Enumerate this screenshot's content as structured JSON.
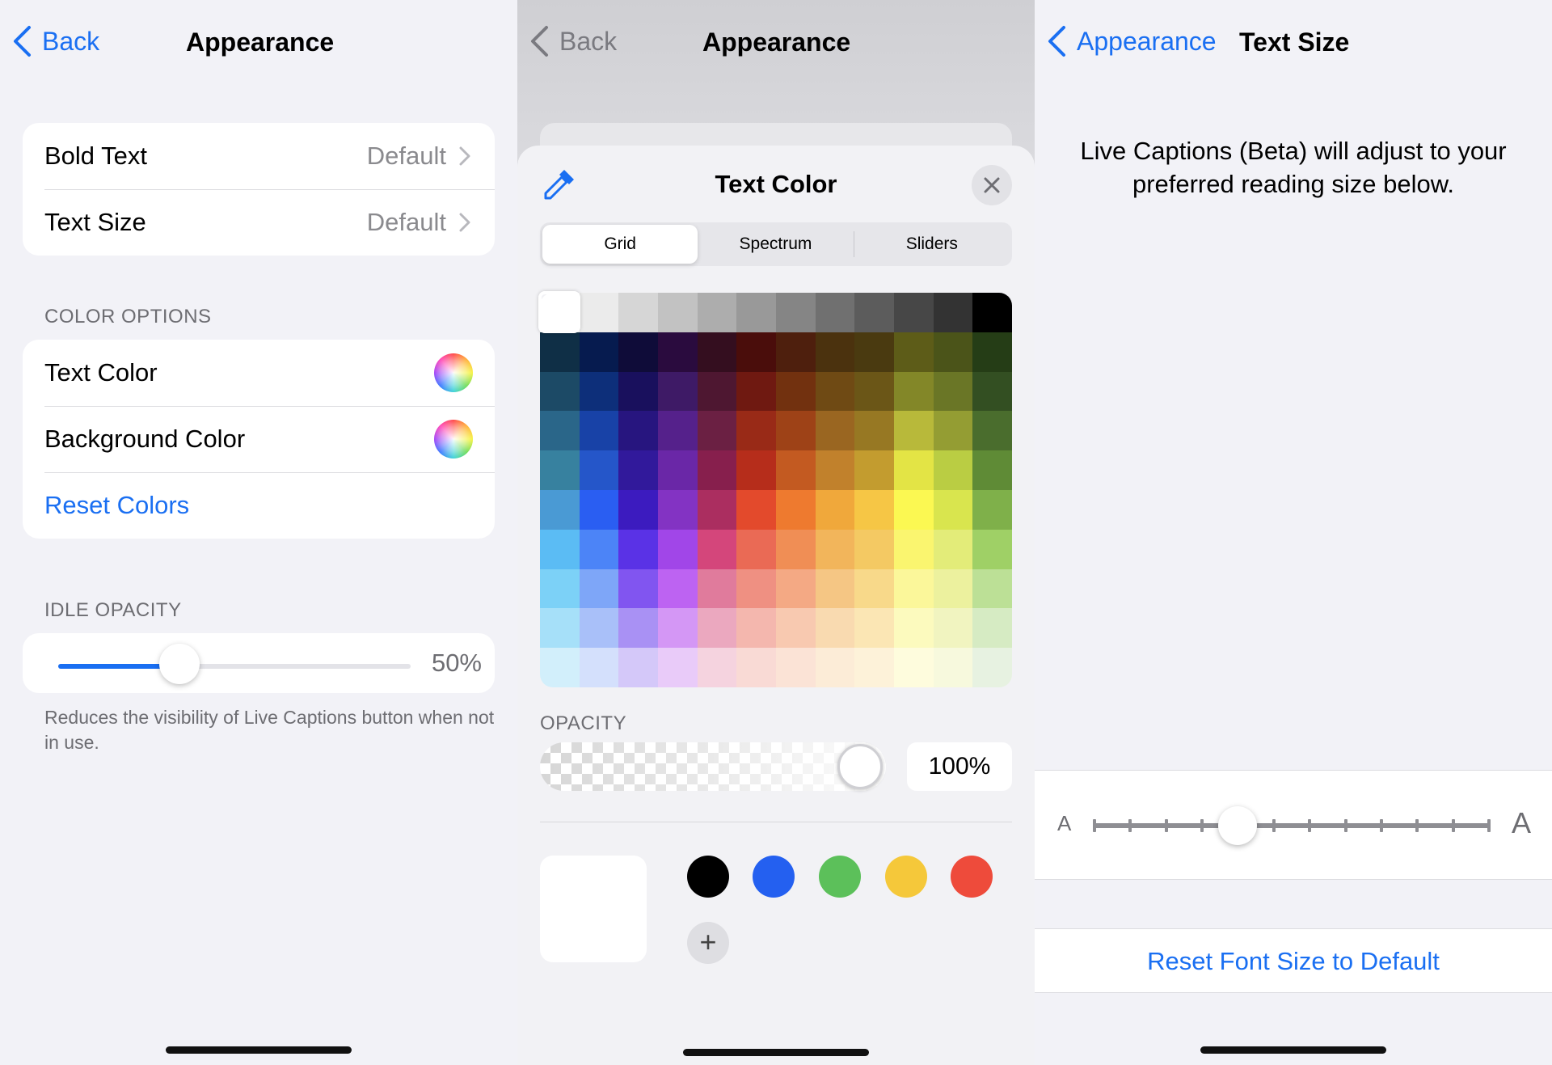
{
  "panel1": {
    "nav": {
      "back_label": "Back",
      "title": "Appearance"
    },
    "group1": [
      {
        "label": "Bold Text",
        "value": "Default"
      },
      {
        "label": "Text Size",
        "value": "Default"
      }
    ],
    "color_options_header": "COLOR OPTIONS",
    "color_rows": [
      {
        "label": "Text Color",
        "icon": "color-wheel-icon"
      },
      {
        "label": "Background Color",
        "icon": "color-wheel-icon"
      }
    ],
    "reset_colors": "Reset Colors",
    "idle_header": "IDLE OPACITY",
    "idle_opacity": {
      "value": 0.5,
      "label": "50%"
    },
    "footnote": "Reduces the visibility of Live Captions button when not in use."
  },
  "panel2": {
    "nav": {
      "back_label": "Back",
      "title": "Appearance"
    },
    "sheet_title": "Text Color",
    "tabs": [
      {
        "label": "Grid",
        "selected": true
      },
      {
        "label": "Spectrum",
        "selected": false
      },
      {
        "label": "Sliders",
        "selected": false
      }
    ],
    "opacity_label": "OPACITY",
    "opacity_value": "100%",
    "selected_color": "#ffffff",
    "palette_colors": [
      "#000000",
      "#2460f0",
      "#5cc05a",
      "#f5c83a",
      "#ee4b3b"
    ],
    "grid_rows": [
      [
        "#ffffff",
        "#ebebeb",
        "#d6d6d6",
        "#c2c2c2",
        "#adadad",
        "#999999",
        "#858585",
        "#707070",
        "#5c5c5c",
        "#474747",
        "#333333",
        "#000000"
      ],
      [
        "#0f2f46",
        "#061b4f",
        "#0f0c39",
        "#2a0b3e",
        "#340e1f",
        "#4a0d0b",
        "#4e1f0d",
        "#4b320e",
        "#4a3a10",
        "#5d5c18",
        "#4b5419",
        "#253d16"
      ],
      [
        "#1c4a66",
        "#0d2f7a",
        "#19105d",
        "#3e1a66",
        "#4e1731",
        "#6f1911",
        "#72310f",
        "#6f4a14",
        "#6b5617",
        "#838728",
        "#6a7626",
        "#334f22"
      ],
      [
        "#2a6689",
        "#1842a7",
        "#27157f",
        "#55218b",
        "#6b2043",
        "#992a17",
        "#9e4217",
        "#9a6621",
        "#977823",
        "#b8b93a",
        "#949d33",
        "#4a6d2d"
      ],
      [
        "#37819f",
        "#2556c9",
        "#31199b",
        "#6a27a7",
        "#871f4d",
        "#b62d1b",
        "#c35a21",
        "#c1812c",
        "#c39c2f",
        "#e3e445",
        "#bacd43",
        "#5f8b36"
      ],
      [
        "#4a9ad4",
        "#2a5ef2",
        "#3c1bbf",
        "#8333c3",
        "#ab2e60",
        "#e34a2c",
        "#ee7a2f",
        "#f0a83b",
        "#f6c645",
        "#fbf852",
        "#d9e54e",
        "#7fb04a"
      ],
      [
        "#5bbcf4",
        "#4c84f7",
        "#5a32e6",
        "#a146e8",
        "#d4467b",
        "#ea6a55",
        "#f08e55",
        "#f2b55b",
        "#f4c963",
        "#faf56f",
        "#e3ec79",
        "#9fd066"
      ],
      [
        "#7cd1f7",
        "#7ea6f8",
        "#8155f0",
        "#bd63f2",
        "#e07b9c",
        "#ef9082",
        "#f4a984",
        "#f5c684",
        "#f8d98a",
        "#fbf79a",
        "#ecf19e",
        "#bce096"
      ],
      [
        "#a6e0f9",
        "#a9c0f9",
        "#a991f4",
        "#d497f5",
        "#eba8bf",
        "#f4b7ae",
        "#f8c9b0",
        "#f9dab0",
        "#fbe6b4",
        "#fcfabe",
        "#f1f4c0",
        "#d6ebc3"
      ],
      [
        "#d2effb",
        "#d4e0fc",
        "#d4c8f9",
        "#e9cbf9",
        "#f5d3df",
        "#f9dad5",
        "#fbe3d6",
        "#fcecd7",
        "#fdf2d9",
        "#fefcdd",
        "#f7f9dd",
        "#e7f2e1"
      ]
    ]
  },
  "panel3": {
    "nav": {
      "back_label": "Appearance",
      "title": "Text Size"
    },
    "description": "Live Captions (Beta) will adjust to your preferred reading size below.",
    "slider": {
      "small_label": "A",
      "large_label": "A",
      "steps": 12,
      "selected_step": 4
    },
    "reset_button": "Reset Font Size to Default"
  }
}
